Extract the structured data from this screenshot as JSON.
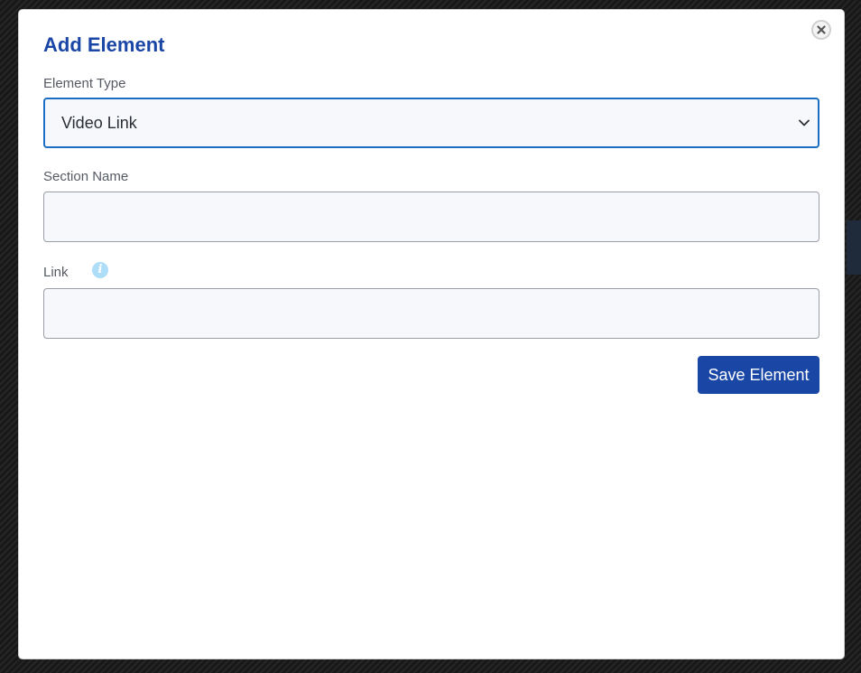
{
  "modal": {
    "title": "Add Element",
    "close_icon": "close-icon"
  },
  "form": {
    "element_type": {
      "label": "Element Type",
      "selected": "Video Link",
      "icon": "chevron-down-icon"
    },
    "section_name": {
      "label": "Section Name",
      "value": "",
      "placeholder": ""
    },
    "link": {
      "label": "Link",
      "value": "",
      "placeholder": "",
      "info_icon": "info-icon",
      "info_glyph": "i"
    },
    "save_label": "Save Element"
  },
  "colors": {
    "accent": "#1a46a6",
    "focus_border": "#1a6fc4",
    "info_icon": "#aeddf7",
    "field_bg": "#f7f8fb"
  }
}
